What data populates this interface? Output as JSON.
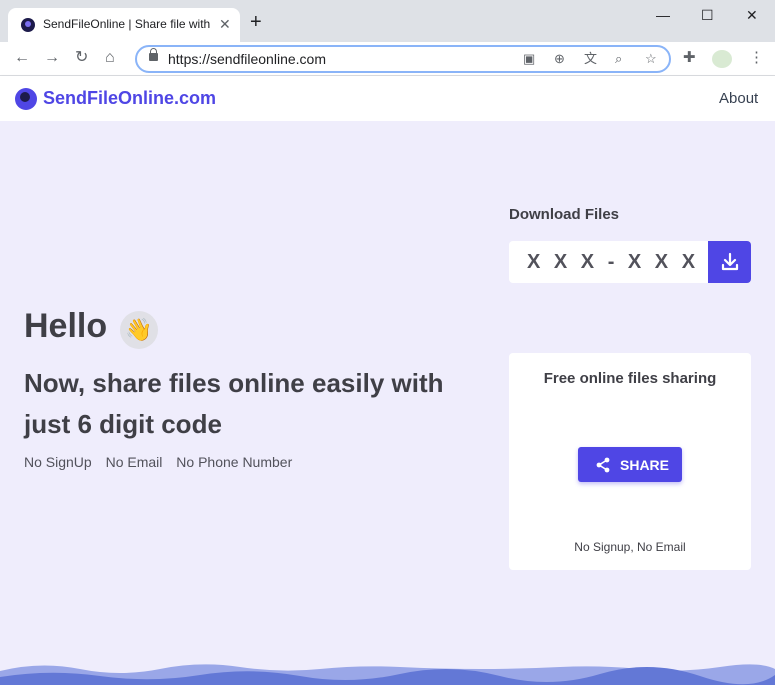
{
  "browser": {
    "tab_title": "SendFileOnline | Share file with",
    "tab_close_icon": "close-icon",
    "new_tab_symbol": "+",
    "minimize_symbol": "—",
    "maximize_symbol": "☐",
    "close_symbol": "✕",
    "back_symbol": "←",
    "forward_symbol": "→",
    "reload_symbol": "↻",
    "home_symbol": "⌂",
    "url": "https://sendfileonline.com"
  },
  "header": {
    "logo_text": "SendFileOnline.com",
    "about_link": "About"
  },
  "hero": {
    "greeting": "Hello",
    "wave_emoji": "👋",
    "headline": "Now, share files online easily with just 6 digit code",
    "features": [
      "No SignUp",
      "No Email",
      "No Phone Number"
    ]
  },
  "download": {
    "title": "Download Files",
    "placeholder": "X X X - X X X"
  },
  "share": {
    "title": "Free online files sharing",
    "button_label": "SHARE",
    "footer": "No Signup, No Email"
  },
  "colors": {
    "brand": "#4f46e5",
    "background": "#efedfc"
  }
}
